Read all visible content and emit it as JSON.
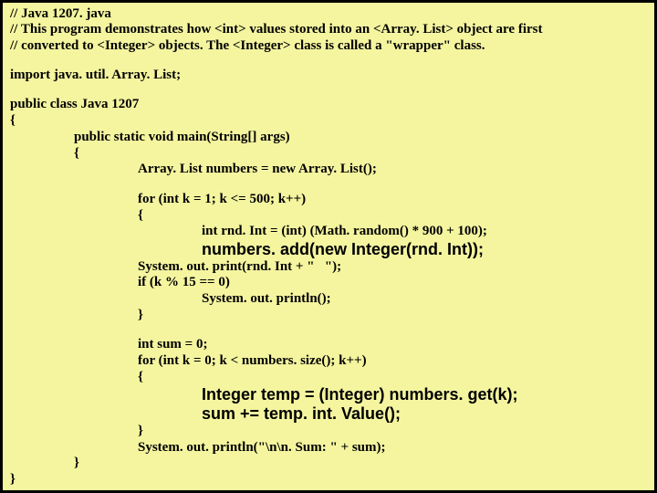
{
  "comments": {
    "l1": "// Java 1207. java",
    "l2": "// This program demonstrates how <int> values stored into an <Array. List> object are first",
    "l3": "// converted to <Integer> objects.  The <Integer> class is called a \"wrapper\" class."
  },
  "code": {
    "import": "import java. util. Array. List;",
    "classDecl": "public class Java 1207",
    "openBrace": "{",
    "mainSig": "public static void main(String[] args)",
    "mainOpen": "{",
    "declNumbers": "Array. List numbers = new Array. List();",
    "for1": "for (int k = 1; k <= 500; k++)",
    "for1Open": "{",
    "rndInt": "int rnd. Int = (int) (Math. random() * 900 + 100);",
    "addLine": "numbers. add(new Integer(rnd. Int));",
    "print": "System. out. print(rnd. Int + \"   \");",
    "ifLine": "if (k % 15 == 0)",
    "println1": "System. out. println();",
    "for1Close": "}",
    "sumDecl": "int sum = 0;",
    "for2": "for (int k = 0; k < numbers. size(); k++)",
    "for2Open": "{",
    "tempLine": "Integer temp = (Integer) numbers. get(k);",
    "sumLine": "sum += temp. int. Value();",
    "for2Close": "}",
    "printSum": "System. out. println(\"\\n\\n. Sum: \" + sum);",
    "mainClose": "}",
    "classClose": "}"
  }
}
